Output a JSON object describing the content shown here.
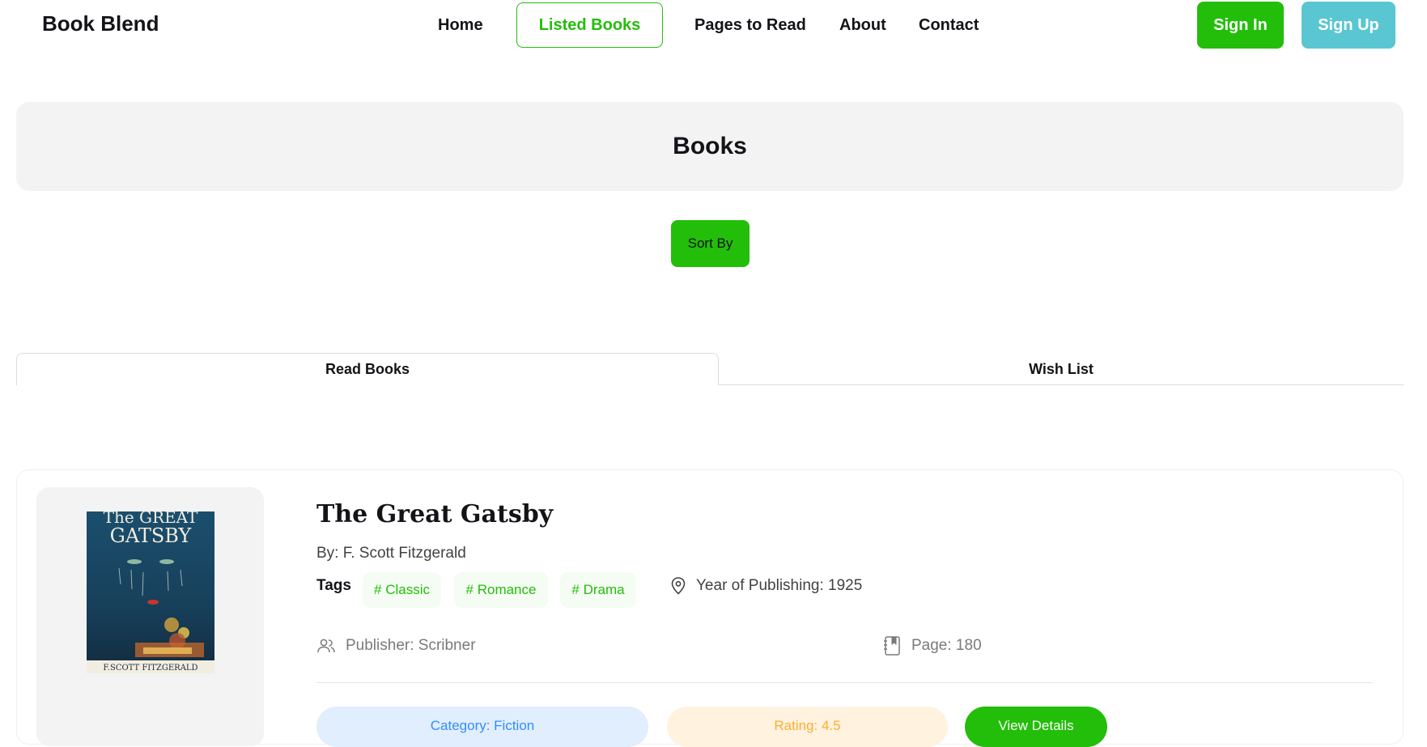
{
  "nav": {
    "brand": "Book Blend",
    "links": [
      "Home",
      "Listed Books",
      "Pages to Read",
      "About",
      "Contact"
    ],
    "active": "Listed Books",
    "sign_in": "Sign In",
    "sign_up": "Sign Up"
  },
  "banner": {
    "title": "Books"
  },
  "sort": {
    "label": "Sort By"
  },
  "tabs": [
    {
      "label": "Read Books",
      "active": true
    },
    {
      "label": "Wish List",
      "active": false
    }
  ],
  "book": {
    "title": "The Great Gatsby",
    "author": "By: F. Scott Fitzgerald",
    "tags_label": "Tags",
    "tags": [
      "# Classic",
      "# Romance",
      "# Drama"
    ],
    "year": "Year of Publishing: 1925",
    "publisher": "Publisher: Scribner",
    "pages": "Page: 180",
    "category": "Category: Fiction",
    "rating": "Rating: 4.5",
    "details_button": "View Details",
    "cover_lettering": {
      "title_line1": "The GREAT",
      "title_line2": "GATSBY",
      "author": "F.SCOTT FITZGERALD"
    }
  },
  "colors": {
    "accent": "#23BE0A",
    "signup": "#59C6D2",
    "category": "#328EFF",
    "rating": "#FFAC33"
  },
  "icons": [
    "location-pin-icon",
    "users-icon",
    "book-pages-icon"
  ]
}
